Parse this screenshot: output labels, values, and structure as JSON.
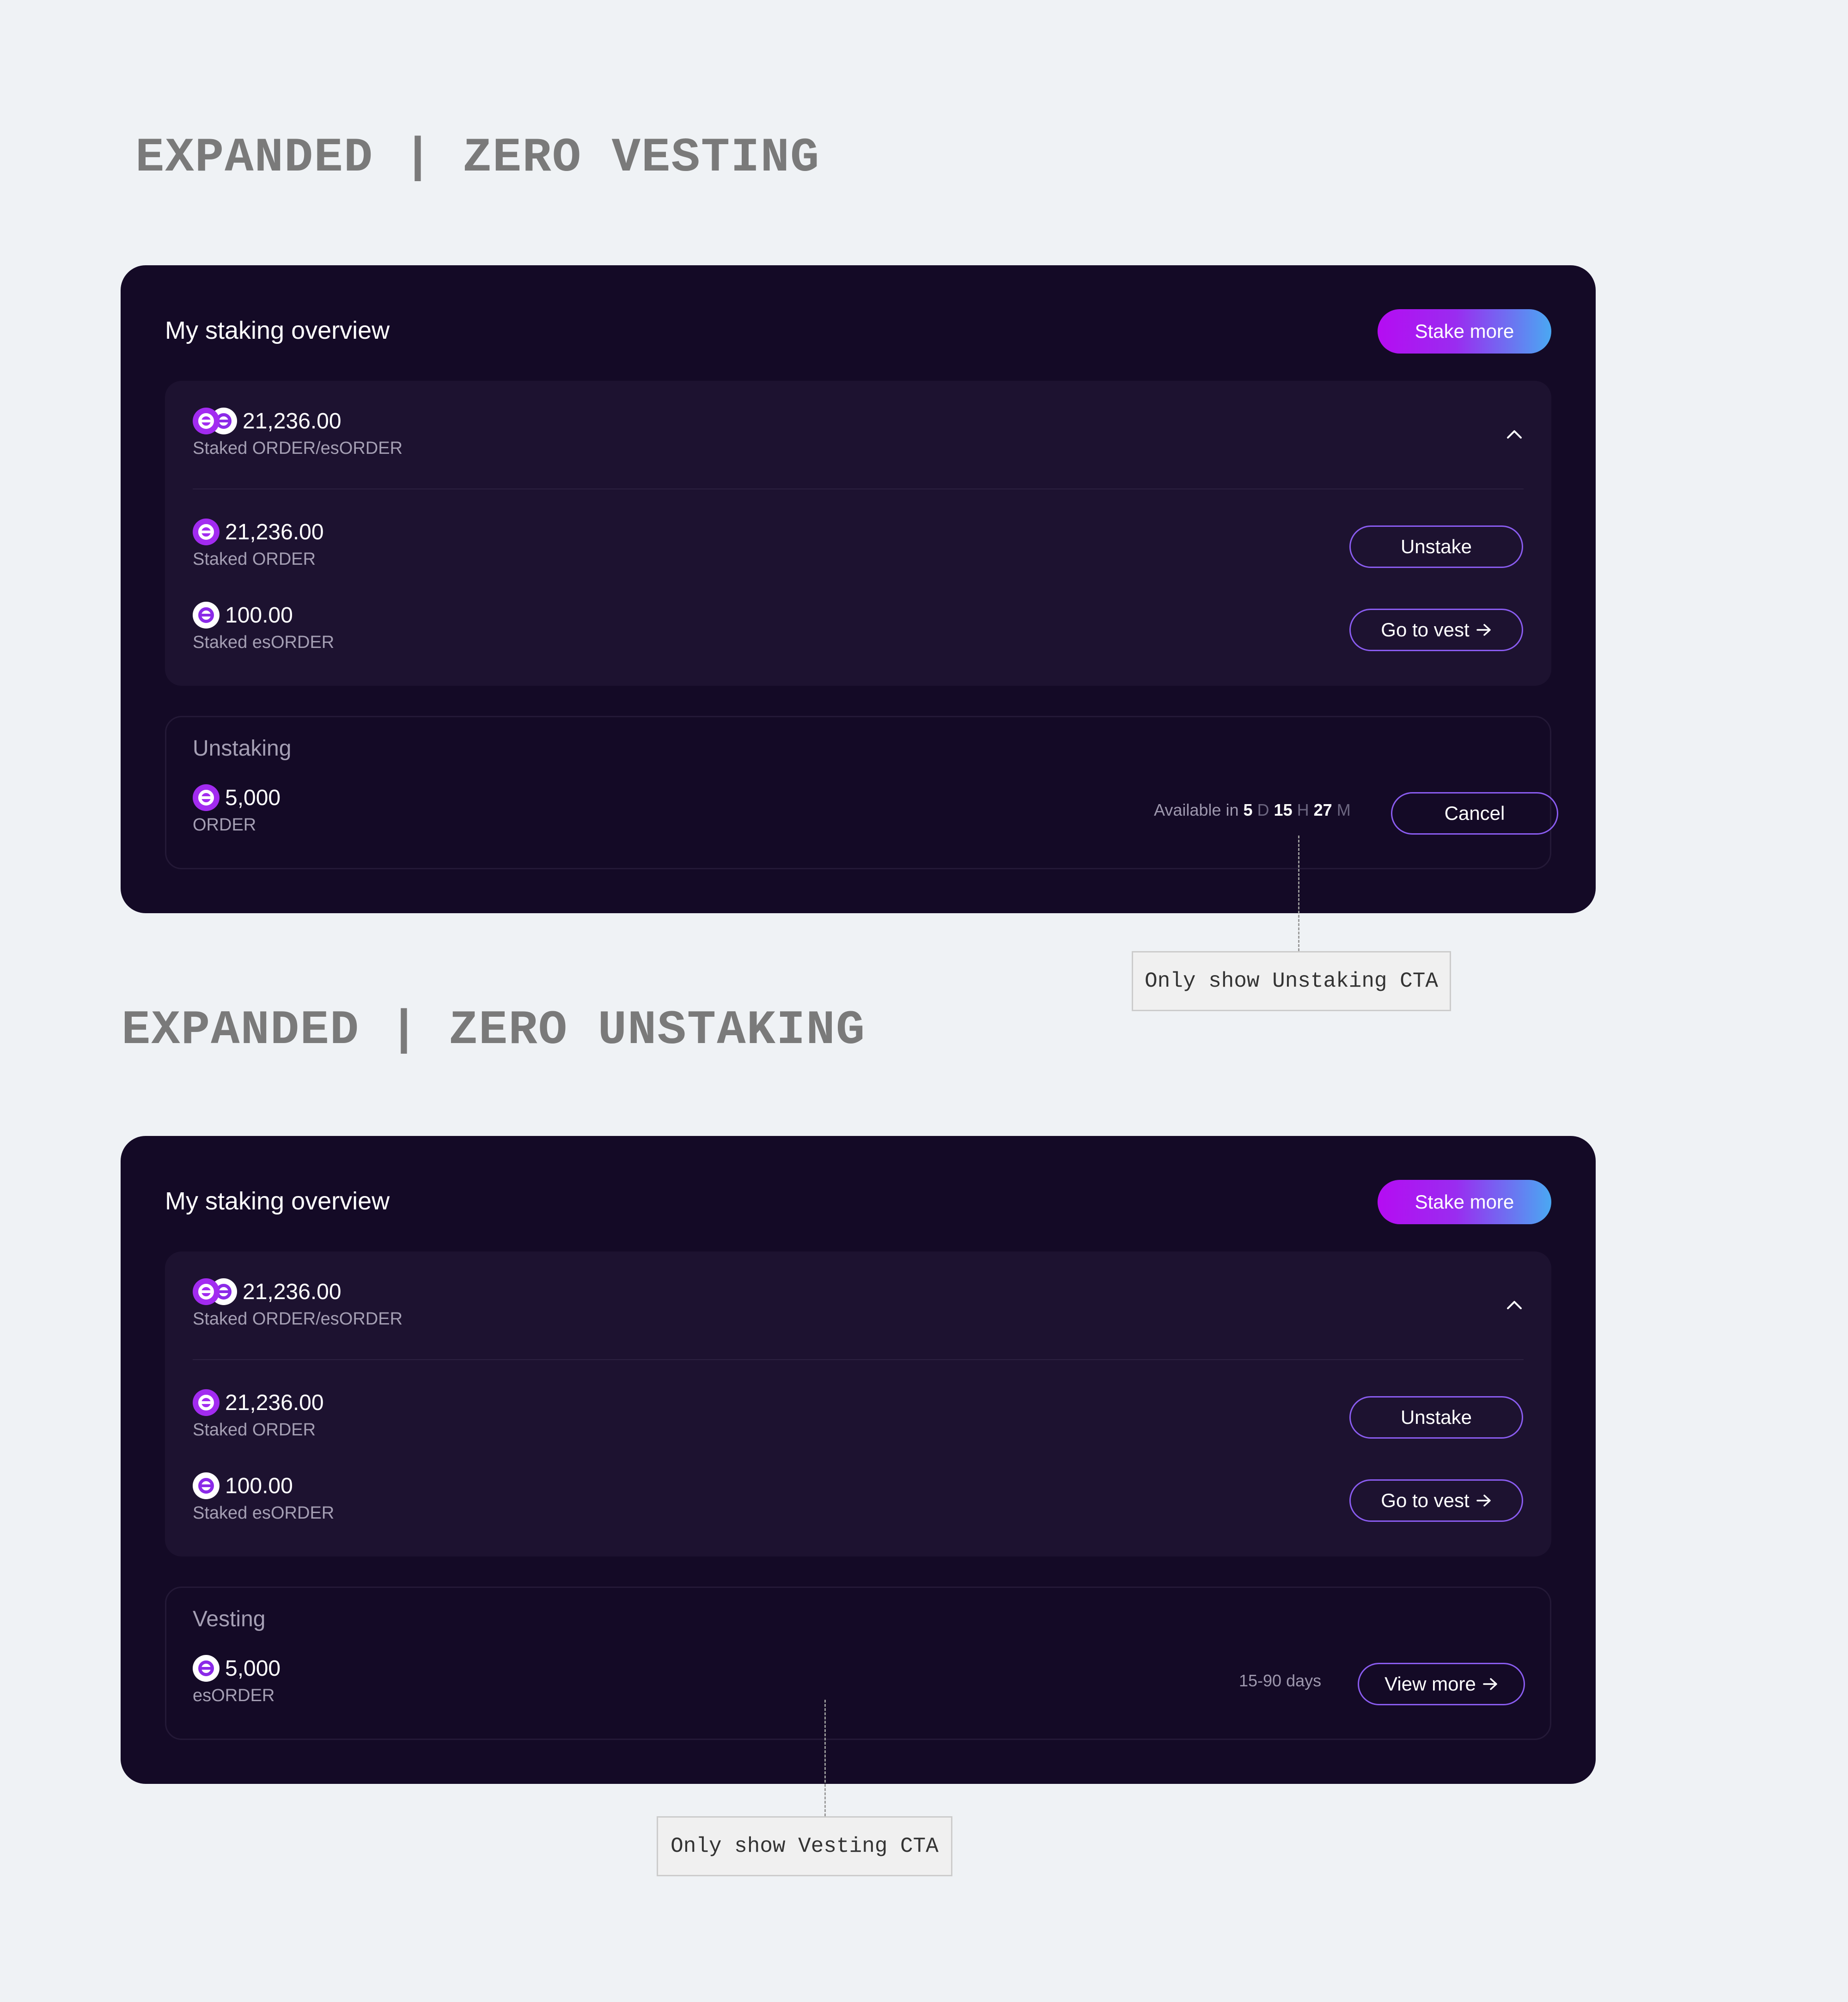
{
  "sections": [
    {
      "heading": "EXPANDED | ZERO VESTING",
      "panel": {
        "title": "My staking overview",
        "stake_more_label": "Stake more",
        "total": {
          "amount": "21,236.00",
          "label": "Staked ORDER/esORDER",
          "icon": "order-esorder-coin-pair-icon"
        },
        "staked_order": {
          "amount": "21,236.00",
          "label": "Staked ORDER",
          "button": "Unstake",
          "icon": "order-coin-icon"
        },
        "staked_esorder": {
          "amount": "100.00",
          "label": "Staked esORDER",
          "button": "Go to vest",
          "icon": "esorder-coin-icon"
        },
        "secondary": {
          "title": "Unstaking",
          "amount": "5,000",
          "label": "ORDER",
          "note": {
            "prefix": "Available in",
            "d_val": "5",
            "d_unit": "D",
            "h_val": "15",
            "h_unit": "H",
            "m_val": "27",
            "m_unit": "M"
          },
          "button": "Cancel"
        }
      },
      "callout": "Only show Unstaking CTA"
    },
    {
      "heading": "EXPANDED | ZERO UNSTAKING",
      "panel": {
        "title": "My staking overview",
        "stake_more_label": "Stake more",
        "total": {
          "amount": "21,236.00",
          "label": "Staked ORDER/esORDER",
          "icon": "order-esorder-coin-pair-icon"
        },
        "staked_order": {
          "amount": "21,236.00",
          "label": "Staked ORDER",
          "button": "Unstake",
          "icon": "order-coin-icon"
        },
        "staked_esorder": {
          "amount": "100.00",
          "label": "Staked esORDER",
          "button": "Go to vest",
          "icon": "esorder-coin-icon"
        },
        "secondary": {
          "title": "Vesting",
          "amount": "5,000",
          "label": "esORDER",
          "note_text": "15-90 days",
          "button": "View more"
        }
      },
      "callout": "Only show Vesting CTA"
    }
  ],
  "colors": {
    "background": "#eff2f5",
    "panel": "#140a26",
    "staked_box": "#1d1230",
    "accent_purple": "#a22bf0",
    "button_outline": "#8a5cf0",
    "gradient_start": "#b50cf2",
    "gradient_end": "#4aa8f2"
  }
}
